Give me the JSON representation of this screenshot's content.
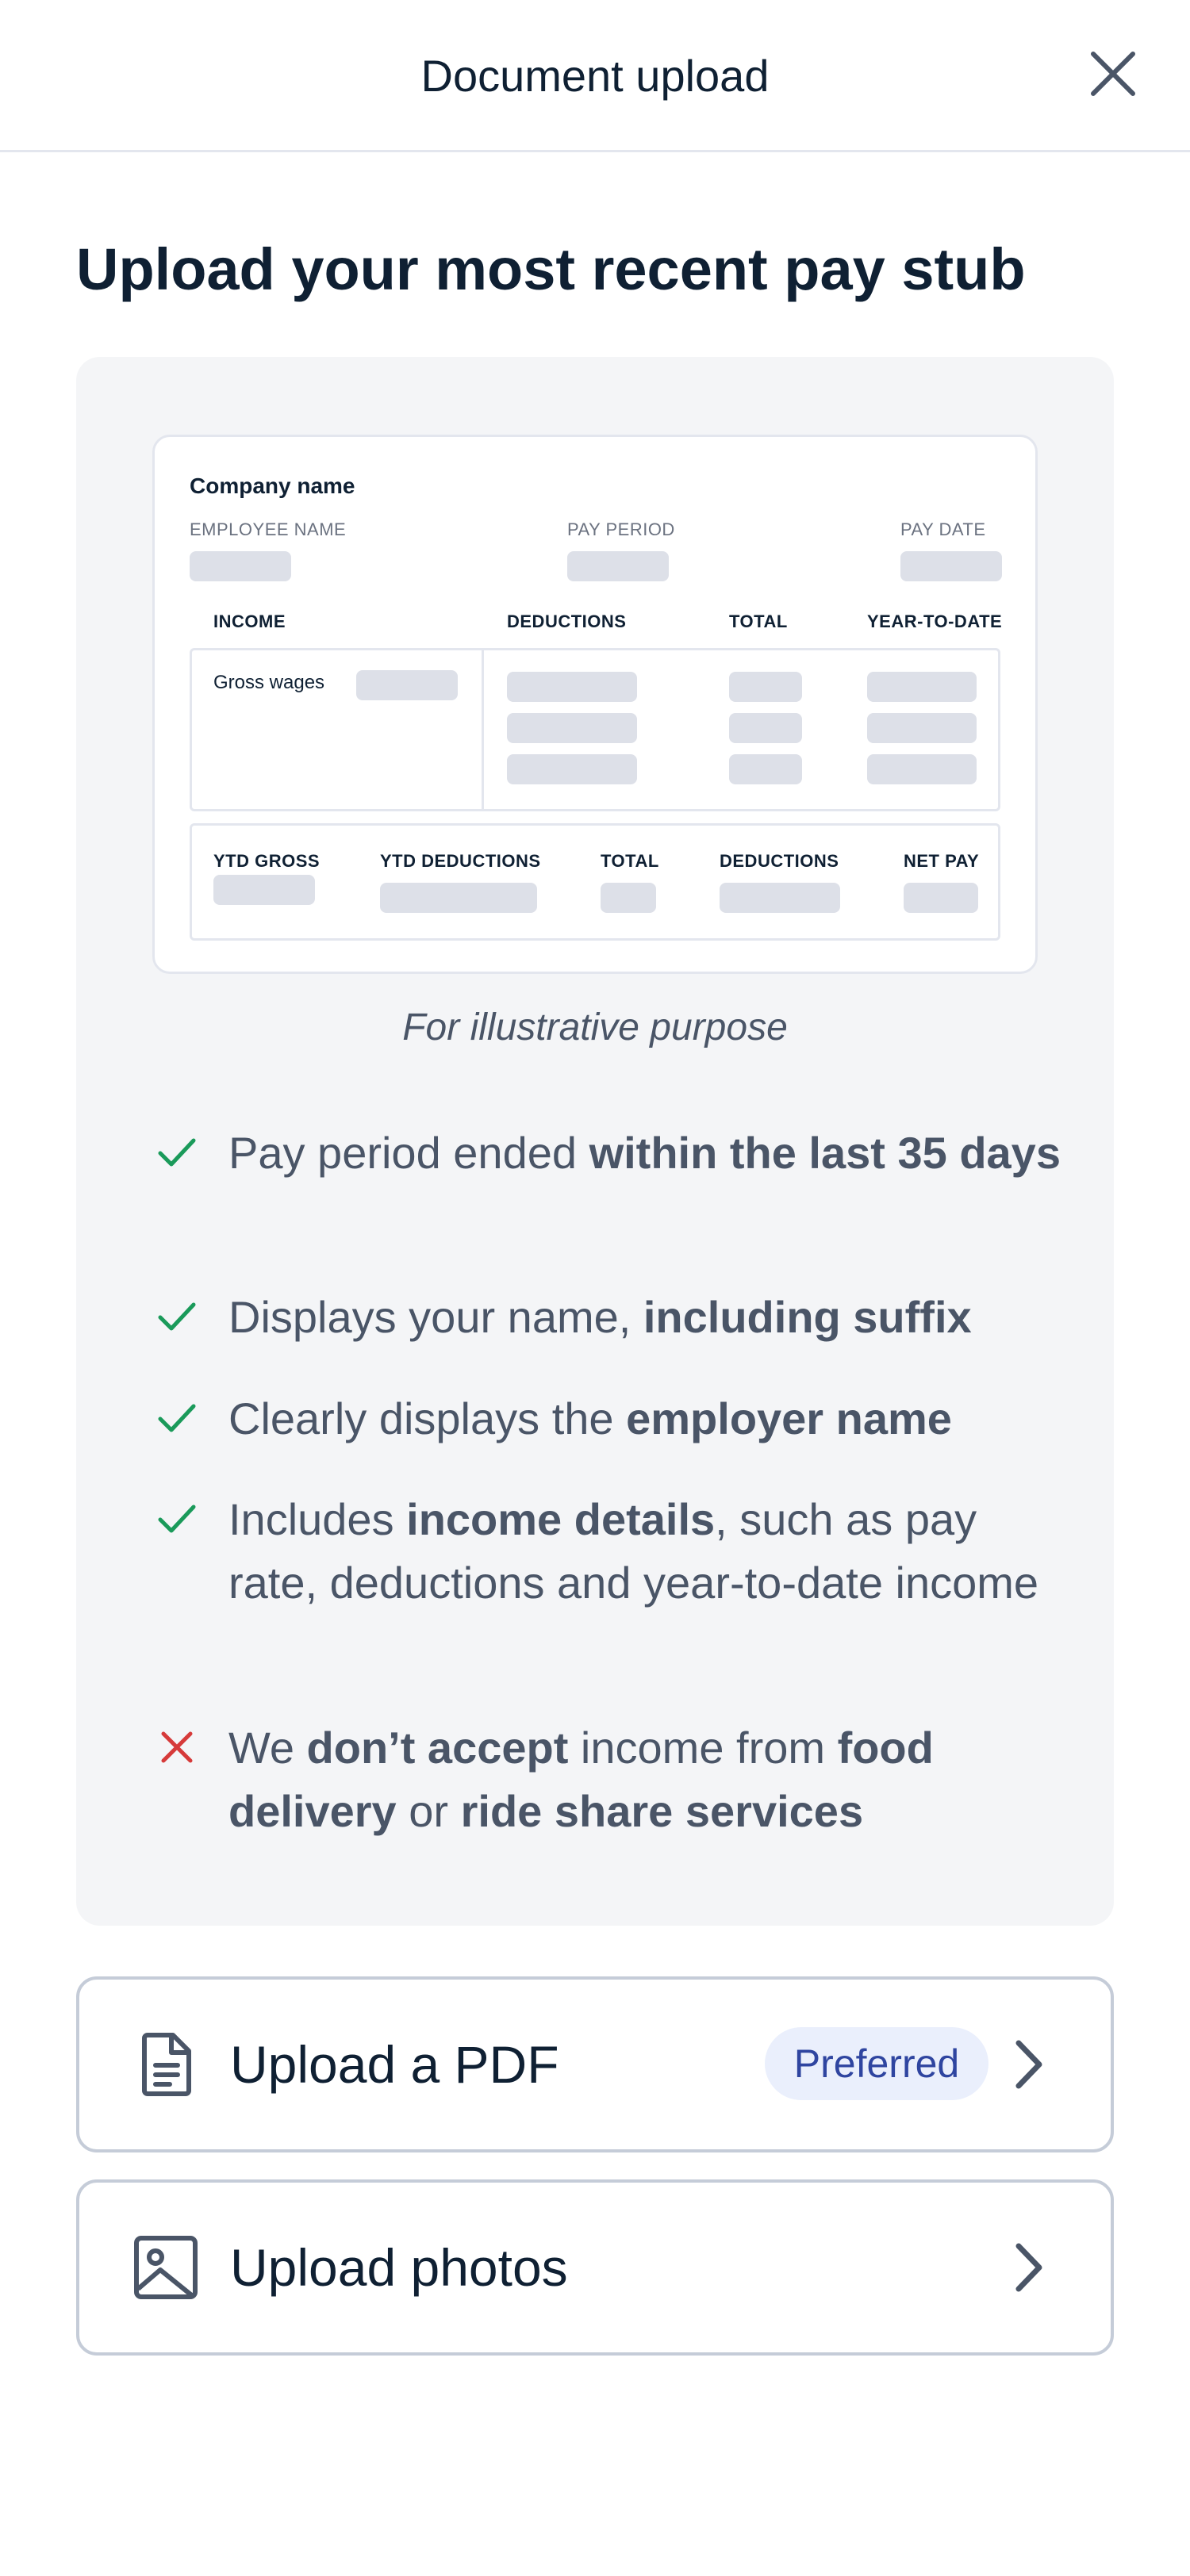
{
  "header": {
    "title": "Document upload",
    "close_icon": "close-icon"
  },
  "page": {
    "heading": "Upload your most recent pay stub"
  },
  "sample_stub": {
    "company": "Company name",
    "employee_name_label": "EMPLOYEE NAME",
    "pay_period_label": "PAY PERIOD",
    "pay_date_label": "PAY DATE",
    "income_header": "INCOME",
    "deductions_header": "DEDUCTIONS",
    "total_header": "TOTAL",
    "ytd_header": "YEAR-TO-DATE",
    "gross_wages": "Gross wages",
    "footer": {
      "ytd_gross": "YTD GROSS",
      "ytd_deductions": "YTD DEDUCTIONS",
      "total": "TOTAL",
      "deductions": "DEDUCTIONS",
      "net_pay": "NET PAY"
    }
  },
  "caption": "For illustrative purpose",
  "requirements": [
    {
      "icon": "check-icon",
      "parts": [
        "Pay period ended ",
        "within the last 35 days"
      ]
    },
    {
      "icon": "check-icon",
      "parts": [
        "Displays your name, ",
        "including suffix"
      ]
    },
    {
      "icon": "check-icon",
      "parts": [
        "Clearly displays the ",
        "employer name"
      ]
    },
    {
      "icon": "check-icon",
      "parts": [
        "Includes ",
        "income details",
        ", such as pay rate, deductions and year-to-date income"
      ]
    },
    {
      "icon": "x-icon",
      "parts": [
        "We ",
        "don’t accept",
        " income from ",
        "food delivery",
        " or ",
        "ride share services"
      ]
    }
  ],
  "actions": {
    "pdf": {
      "label": "Upload a PDF",
      "badge": "Preferred",
      "icon": "document-icon"
    },
    "photos": {
      "label": "Upload photos",
      "icon": "image-icon"
    }
  },
  "colors": {
    "check": "#1a9a5a",
    "cross": "#d63a3a",
    "badge_bg": "#eaeffc",
    "badge_text": "#2f45a0"
  }
}
